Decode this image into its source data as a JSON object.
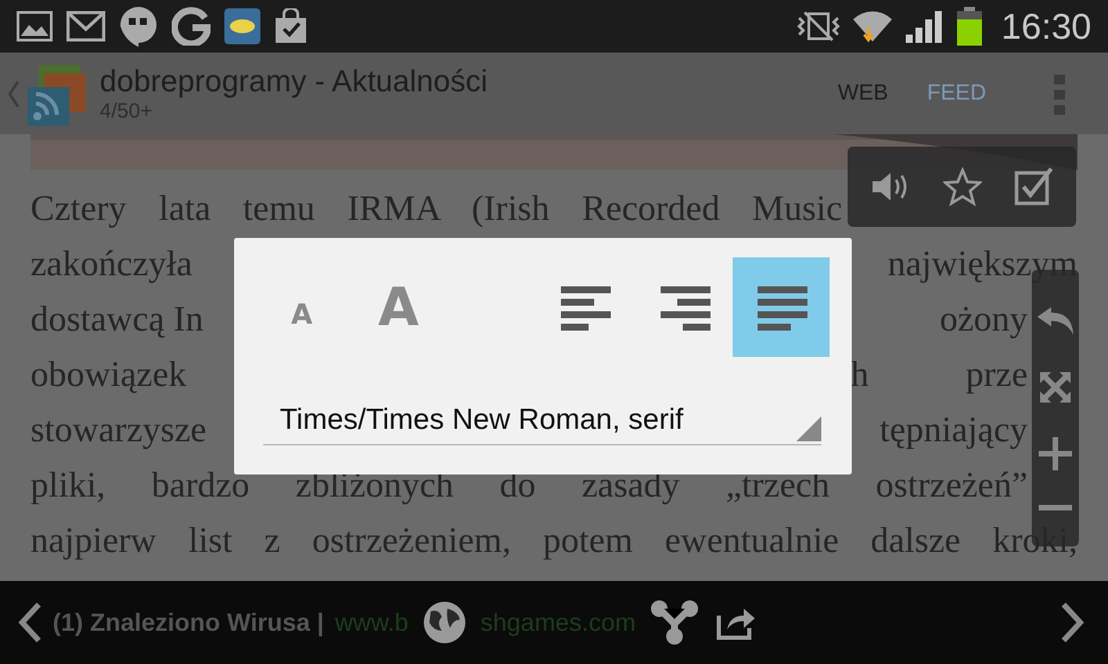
{
  "status_bar": {
    "time": "16:30"
  },
  "app_bar": {
    "title": "dobreprogramy - Aktualności",
    "subtitle": "4/50+",
    "tabs": [
      {
        "label": "WEB",
        "selected": false
      },
      {
        "label": "FEED",
        "selected": true
      }
    ]
  },
  "article": {
    "lines": [
      [
        "Cztery lata temu IRMA (Irish Recorded Music"
      ],
      [
        "zakończyła",
        "największym"
      ],
      [
        "dostawcą In",
        "ożony"
      ],
      [
        "obowiązek",
        "h",
        "prze"
      ],
      [
        "stowarzysze",
        "tępniający"
      ],
      [
        "pliki, bardzo zbliżonych do zasady „trzech ostrzeżeń”"
      ],
      [
        "najpierw list z ostrzeżeniem, potem ewentualnie dalsze kroki,"
      ]
    ]
  },
  "text_dialog": {
    "size_buttons": [
      {
        "label": "A",
        "kind": "small"
      },
      {
        "label": "A",
        "kind": "large"
      }
    ],
    "align_buttons": [
      {
        "kind": "left",
        "selected": false
      },
      {
        "kind": "right",
        "selected": false
      },
      {
        "kind": "justify",
        "selected": true
      }
    ],
    "font": {
      "value": "Times/Times New Roman, serif"
    }
  },
  "bottom_bar": {
    "ticker_title": "(1) Znaleziono Wirusa |",
    "ticker_link": [
      "www.b",
      "shgames.com"
    ]
  }
}
